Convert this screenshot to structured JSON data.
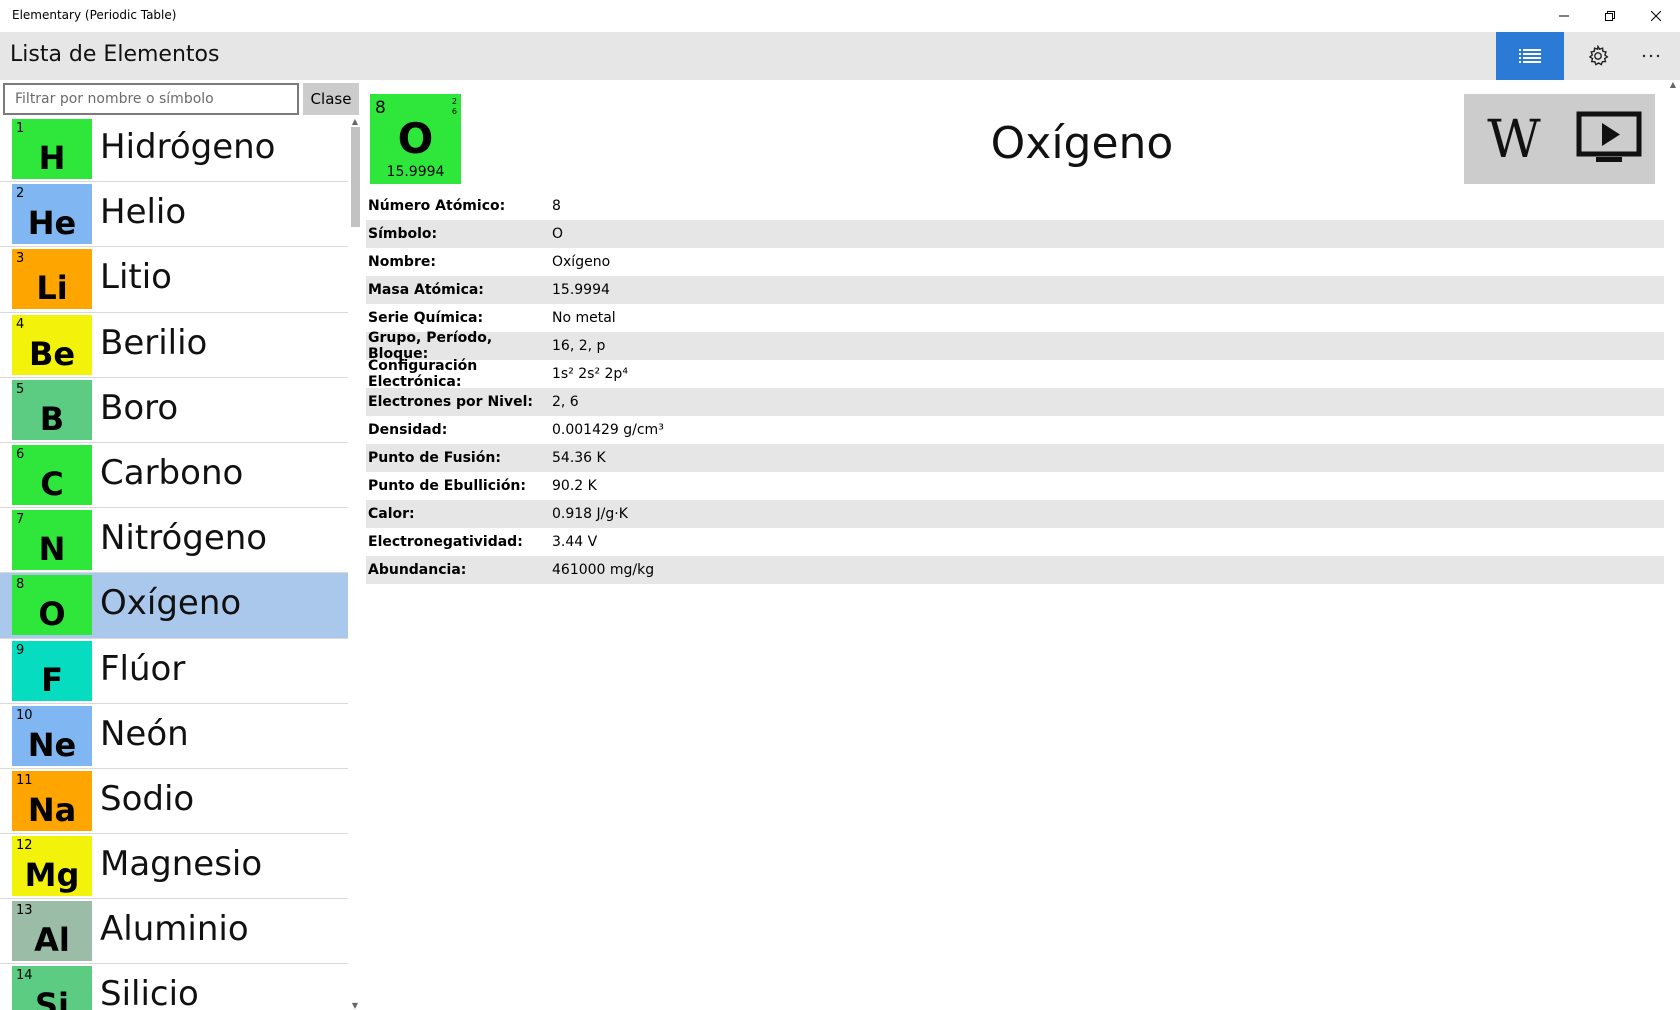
{
  "window": {
    "title": "Elementary (Periodic Table)"
  },
  "header": {
    "title": "Lista de Elementos"
  },
  "filter": {
    "placeholder": "Filtrar por nombre o símbolo",
    "clase_label": "Clase"
  },
  "elements": [
    {
      "number": "1",
      "symbol": "H",
      "name": "Hidrógeno",
      "color": "#2ee73a"
    },
    {
      "number": "2",
      "symbol": "He",
      "name": "Helio",
      "color": "#80b7f2"
    },
    {
      "number": "3",
      "symbol": "Li",
      "name": "Litio",
      "color": "#ffa500"
    },
    {
      "number": "4",
      "symbol": "Be",
      "name": "Berilio",
      "color": "#f2f20a"
    },
    {
      "number": "5",
      "symbol": "B",
      "name": "Boro",
      "color": "#5bcc82"
    },
    {
      "number": "6",
      "symbol": "C",
      "name": "Carbono",
      "color": "#2ee73a"
    },
    {
      "number": "7",
      "symbol": "N",
      "name": "Nitrógeno",
      "color": "#2ee73a"
    },
    {
      "number": "8",
      "symbol": "O",
      "name": "Oxígeno",
      "color": "#2ee73a"
    },
    {
      "number": "9",
      "symbol": "F",
      "name": "Flúor",
      "color": "#06dcc0"
    },
    {
      "number": "10",
      "symbol": "Ne",
      "name": "Neón",
      "color": "#80b7f2"
    },
    {
      "number": "11",
      "symbol": "Na",
      "name": "Sodio",
      "color": "#ffa500"
    },
    {
      "number": "12",
      "symbol": "Mg",
      "name": "Magnesio",
      "color": "#f2f20a"
    },
    {
      "number": "13",
      "symbol": "Al",
      "name": "Aluminio",
      "color": "#9bbca6"
    },
    {
      "number": "14",
      "symbol": "Si",
      "name": "Silicio",
      "color": "#5bcc82"
    }
  ],
  "selected_index": 7,
  "detail": {
    "number": "8",
    "symbol": "O",
    "mass": "15.9994",
    "shells": [
      "2",
      "6"
    ],
    "name": "Oxígeno",
    "tile_color": "#2ee73a",
    "properties": [
      {
        "label": "Número Atómico:",
        "value": "8"
      },
      {
        "label": "Símbolo:",
        "value": "O"
      },
      {
        "label": "Nombre:",
        "value": "Oxígeno"
      },
      {
        "label": "Masa Atómica:",
        "value": "15.9994"
      },
      {
        "label": "Serie Química:",
        "value": "No metal"
      },
      {
        "label": "Grupo, Período, Bloque:",
        "value": "16, 2, p"
      },
      {
        "label": "Configuración Electrónica:",
        "value": "1s² 2s² 2p⁴"
      },
      {
        "label": "Electrones por Nivel:",
        "value": "2, 6"
      },
      {
        "label": "Densidad:",
        "value": "0.001429 g/cm³"
      },
      {
        "label": "Punto de Fusión:",
        "value": "54.36 K"
      },
      {
        "label": "Punto de Ebullición:",
        "value": "90.2 K"
      },
      {
        "label": "Calor:",
        "value": "0.918 J/g·K"
      },
      {
        "label": "Electronegatividad:",
        "value": "3.44 V"
      },
      {
        "label": "Abundancia:",
        "value": "461000 mg/kg"
      }
    ]
  },
  "colors": {
    "accent": "#2b7bd6",
    "selected_row": "#a9c8eb",
    "header_bg": "#e6e6e6"
  },
  "icons": {
    "list_view": "list-icon",
    "settings": "gear-icon",
    "more": "more-icon",
    "wikipedia": "wikipedia-icon",
    "video": "video-icon"
  }
}
